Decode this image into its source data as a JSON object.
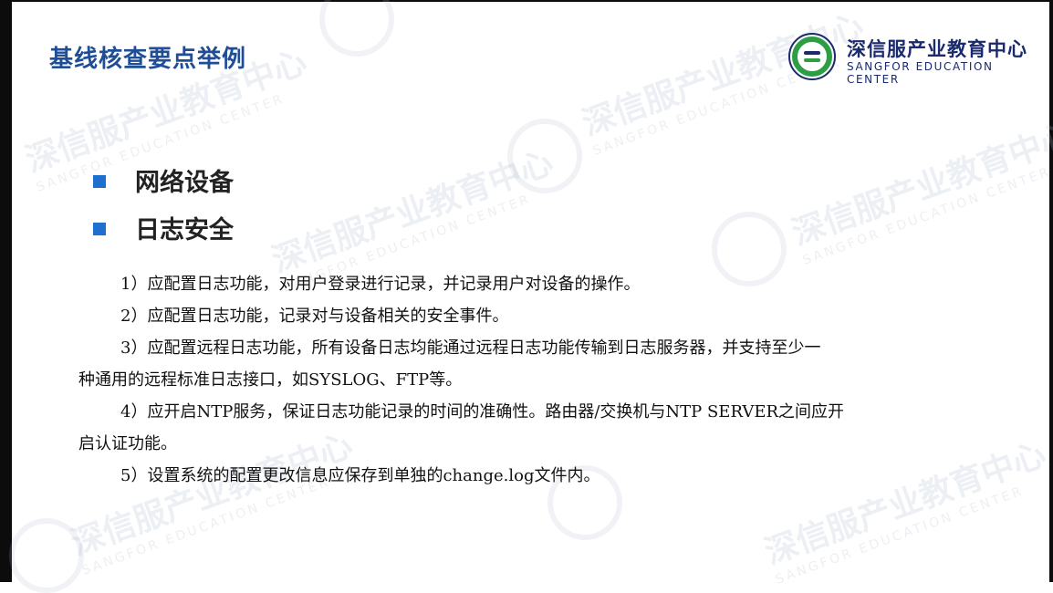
{
  "slide": {
    "title": "基线核查要点举例"
  },
  "logo": {
    "name_cn": "深信服产业教育中心",
    "name_en": "SANGFOR EDUCATION CENTER",
    "emblem_icon": "sangfor-education-emblem-icon",
    "brand_color": "#1a2a6c",
    "accent_green": "#2e9e45"
  },
  "watermark": {
    "cn": "深信服产业教育中心",
    "en": "SANGFOR EDUCATION CENTER"
  },
  "bullets": [
    {
      "label": "网络设备"
    },
    {
      "label": "日志安全"
    }
  ],
  "items": [
    {
      "line1": "1）应配置日志功能，对用户登录进行记录，并记录用户对设备的操作。"
    },
    {
      "line1": "2）应配置日志功能，记录对与设备相关的安全事件。"
    },
    {
      "line1": "3）应配置远程日志功能，所有设备日志均能通过远程日志功能传输到日志服务器，并支持至少一",
      "line2": "种通用的远程标准日志接口，如SYSLOG、FTP等。"
    },
    {
      "line1": "4）应开启NTP服务，保证日志功能记录的时间的准确性。路由器/交换机与NTP SERVER之间应开",
      "line2": "启认证功能。"
    },
    {
      "line1": "5）设置系统的配置更改信息应保存到单独的change.log文件内。"
    }
  ],
  "colors": {
    "title": "#1f4e96",
    "bullet_square": "#1f6fcf"
  }
}
